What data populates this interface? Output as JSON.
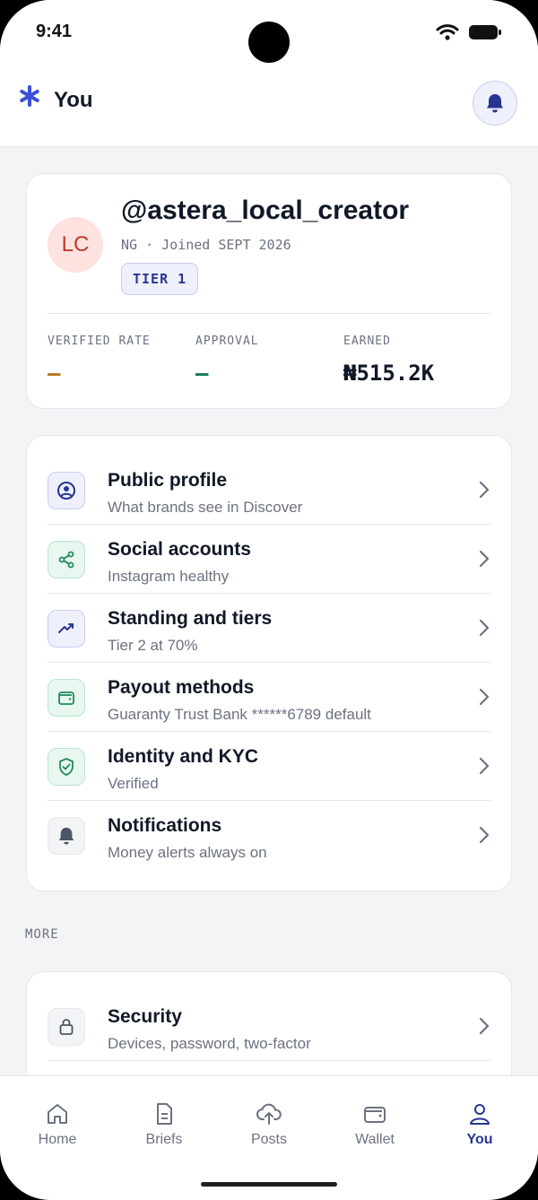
{
  "status_bar": {
    "time": "9:41"
  },
  "header": {
    "title": "You"
  },
  "profile": {
    "initials": "LC",
    "handle": "@astera_local_creator",
    "meta": "NG · Joined SEPT 2026",
    "tier": "TIER 1",
    "stats": [
      {
        "label": "VERIFIED RATE",
        "value": "—",
        "color": "#b7791f"
      },
      {
        "label": "APPROVAL",
        "value": "—",
        "color": "#0f7b5f"
      },
      {
        "label": "EARNED",
        "value": "₦515.2K",
        "color": "#111827"
      }
    ]
  },
  "menu": [
    {
      "title": "Public profile",
      "subtitle": "What brands see in Discover",
      "icon": "user-circle-icon",
      "tone": "indigo"
    },
    {
      "title": "Social accounts",
      "subtitle": "Instagram healthy",
      "icon": "share-icon",
      "tone": "green"
    },
    {
      "title": "Standing and tiers",
      "subtitle": "Tier 2 at 70%",
      "icon": "trending-up-icon",
      "tone": "indigo"
    },
    {
      "title": "Payout methods",
      "subtitle": "Guaranty Trust Bank ******6789 default",
      "icon": "wallet-icon",
      "tone": "green"
    },
    {
      "title": "Identity and KYC",
      "subtitle": "Verified",
      "icon": "shield-check-icon",
      "tone": "green"
    },
    {
      "title": "Notifications",
      "subtitle": "Money alerts always on",
      "icon": "bell-icon",
      "tone": "gray"
    }
  ],
  "more": {
    "label": "MORE",
    "items": [
      {
        "title": "Security",
        "subtitle": "Devices, password, two-factor",
        "icon": "lock-icon"
      }
    ]
  },
  "tabs": [
    {
      "label": "Home",
      "icon": "home-icon",
      "active": false
    },
    {
      "label": "Briefs",
      "icon": "document-icon",
      "active": false
    },
    {
      "label": "Posts",
      "icon": "cloud-upload-icon",
      "active": false
    },
    {
      "label": "Wallet",
      "icon": "wallet-icon",
      "active": false
    },
    {
      "label": "You",
      "icon": "user-icon",
      "active": true
    }
  ],
  "colors": {
    "accent": "#283593",
    "brand_star": "#3b4fd8",
    "green_tone": "#1f8a5c"
  }
}
